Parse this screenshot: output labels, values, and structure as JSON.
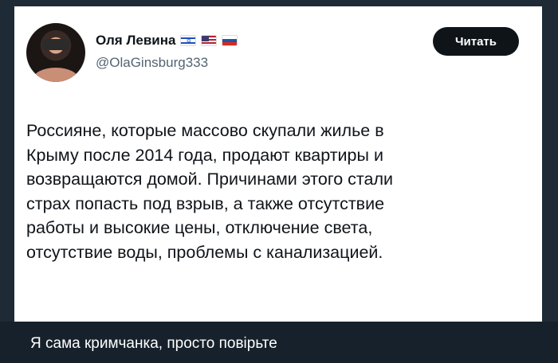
{
  "post": {
    "author_name": "Оля Левина",
    "author_flags": [
      "israel-flag",
      "usa-flag",
      "russia-flag"
    ],
    "author_handle": "@OlaGinsburg333",
    "follow_label": "Читать",
    "text_lines": [
      "Россияне, которые массово скупали жилье в",
      "Крыму после 2014 года, продают квартиры и",
      "возвращаются домой. Причинами этого стали",
      "страх попасть под взрыв, а также отсутствие",
      "работы и высокие цены, отключение света,",
      "отсутствие воды, проблемы с канализацией."
    ]
  },
  "caption": "Я сама кримчанка, просто повірьте",
  "colors": {
    "background": "#17212b",
    "card": "#ffffff",
    "button": "#0f1419",
    "handle": "#536471"
  }
}
